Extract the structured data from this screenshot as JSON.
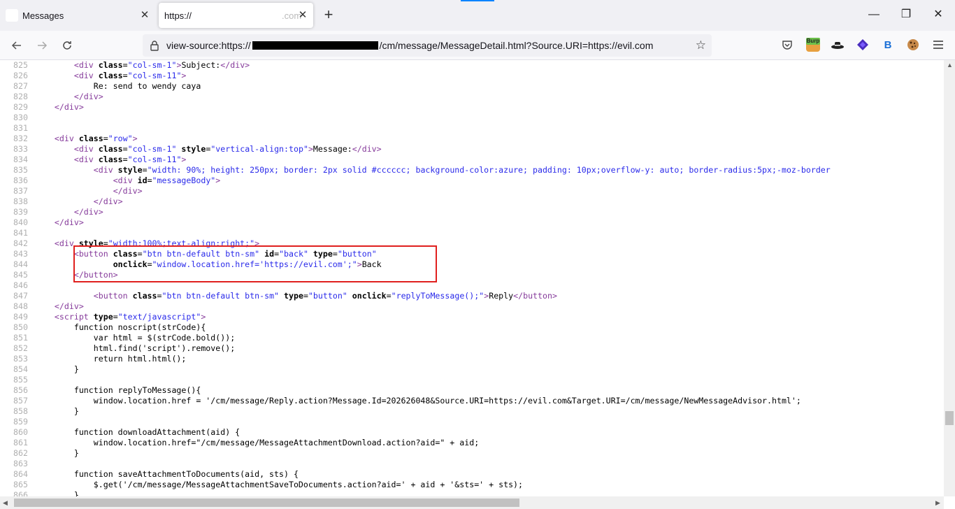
{
  "tabs": [
    {
      "label": "Messages",
      "active": false
    },
    {
      "label": "https://",
      "suffix": ".com",
      "active": true
    }
  ],
  "address": {
    "prefix": "view-source:https://",
    "suffix": "/cm/message/MessageDetail.html?Source.URI=https://evil.com"
  },
  "extensions": [
    {
      "name": "pocket-icon",
      "glyph": "♡"
    },
    {
      "name": "burp-icon",
      "glyph": "Burp"
    },
    {
      "name": "hat-icon",
      "glyph": "🎩"
    },
    {
      "name": "diamond-icon",
      "glyph": "◆"
    },
    {
      "name": "b-icon",
      "glyph": "B"
    },
    {
      "name": "cookie-icon",
      "glyph": "🍪"
    }
  ],
  "colors": {
    "highlight": "#e0201e",
    "tag": "#863b9b",
    "value": "#2a2aea"
  },
  "source_lines": [
    {
      "n": "825",
      "segs": [
        [
          "t",
          "        "
        ],
        [
          "tag",
          "<div"
        ],
        [
          "attr",
          " class"
        ],
        [
          "t",
          "="
        ],
        [
          "val",
          "\"col-sm-1\""
        ],
        [
          "tag",
          ">"
        ],
        [
          "t",
          "Subject:"
        ],
        [
          "tag",
          "</div>"
        ]
      ]
    },
    {
      "n": "826",
      "segs": [
        [
          "t",
          "        "
        ],
        [
          "tag",
          "<div"
        ],
        [
          "attr",
          " class"
        ],
        [
          "t",
          "="
        ],
        [
          "val",
          "\"col-sm-11\""
        ],
        [
          "tag",
          ">"
        ]
      ]
    },
    {
      "n": "827",
      "segs": [
        [
          "t",
          "            Re: send to wendy caya"
        ]
      ]
    },
    {
      "n": "828",
      "segs": [
        [
          "t",
          "        "
        ],
        [
          "tag",
          "</div>"
        ]
      ]
    },
    {
      "n": "829",
      "segs": [
        [
          "t",
          "    "
        ],
        [
          "tag",
          "</div>"
        ]
      ]
    },
    {
      "n": "830",
      "segs": []
    },
    {
      "n": "831",
      "segs": []
    },
    {
      "n": "832",
      "segs": [
        [
          "t",
          "    "
        ],
        [
          "tag",
          "<div"
        ],
        [
          "attr",
          " class"
        ],
        [
          "t",
          "="
        ],
        [
          "val",
          "\"row\""
        ],
        [
          "tag",
          ">"
        ]
      ]
    },
    {
      "n": "833",
      "segs": [
        [
          "t",
          "        "
        ],
        [
          "tag",
          "<div"
        ],
        [
          "attr",
          " class"
        ],
        [
          "t",
          "="
        ],
        [
          "val",
          "\"col-sm-1\""
        ],
        [
          "attr",
          " style"
        ],
        [
          "t",
          "="
        ],
        [
          "val",
          "\"vertical-align:top\""
        ],
        [
          "tag",
          ">"
        ],
        [
          "t",
          "Message:"
        ],
        [
          "tag",
          "</div>"
        ]
      ]
    },
    {
      "n": "834",
      "segs": [
        [
          "t",
          "        "
        ],
        [
          "tag",
          "<div"
        ],
        [
          "attr",
          " class"
        ],
        [
          "t",
          "="
        ],
        [
          "val",
          "\"col-sm-11\""
        ],
        [
          "tag",
          ">"
        ]
      ]
    },
    {
      "n": "835",
      "segs": [
        [
          "t",
          "            "
        ],
        [
          "tag",
          "<div"
        ],
        [
          "attr",
          " style"
        ],
        [
          "t",
          "="
        ],
        [
          "val",
          "\"width: 90%; height: 250px; border: 2px solid #cccccc; background-color:azure; padding: 10px;overflow-y: auto; border-radius:5px;-moz-border"
        ]
      ]
    },
    {
      "n": "836",
      "segs": [
        [
          "t",
          "                "
        ],
        [
          "tag",
          "<div"
        ],
        [
          "attr",
          " id"
        ],
        [
          "t",
          "="
        ],
        [
          "val",
          "\"messageBody\""
        ],
        [
          "tag",
          ">"
        ]
      ]
    },
    {
      "n": "837",
      "segs": [
        [
          "t",
          "                "
        ],
        [
          "tag",
          "</div>"
        ]
      ]
    },
    {
      "n": "838",
      "segs": [
        [
          "t",
          "            "
        ],
        [
          "tag",
          "</div>"
        ]
      ]
    },
    {
      "n": "839",
      "segs": [
        [
          "t",
          "        "
        ],
        [
          "tag",
          "</div>"
        ]
      ]
    },
    {
      "n": "840",
      "segs": [
        [
          "t",
          "    "
        ],
        [
          "tag",
          "</div>"
        ]
      ]
    },
    {
      "n": "841",
      "segs": []
    },
    {
      "n": "842",
      "segs": [
        [
          "t",
          "    "
        ],
        [
          "tag",
          "<div"
        ],
        [
          "attr",
          " style"
        ],
        [
          "t",
          "="
        ],
        [
          "val",
          "\"width:100%;text-align:right;\""
        ],
        [
          "tag",
          ">"
        ]
      ]
    },
    {
      "n": "843",
      "segs": [
        [
          "t",
          "        "
        ],
        [
          "tag",
          "<button"
        ],
        [
          "attr",
          " class"
        ],
        [
          "t",
          "="
        ],
        [
          "val",
          "\"btn btn-default btn-sm\""
        ],
        [
          "attr",
          " id"
        ],
        [
          "t",
          "="
        ],
        [
          "val",
          "\"back\""
        ],
        [
          "attr",
          " type"
        ],
        [
          "t",
          "="
        ],
        [
          "val",
          "\"button\""
        ]
      ]
    },
    {
      "n": "844",
      "segs": [
        [
          "t",
          "                "
        ],
        [
          "attr",
          "onclick"
        ],
        [
          "t",
          "="
        ],
        [
          "val",
          "\"window.location.href='https://evil.com';\""
        ],
        [
          "tag",
          ">"
        ],
        [
          "t",
          "Back"
        ]
      ]
    },
    {
      "n": "845",
      "segs": [
        [
          "t",
          "        "
        ],
        [
          "tag",
          "</button>"
        ]
      ]
    },
    {
      "n": "846",
      "segs": []
    },
    {
      "n": "847",
      "segs": [
        [
          "t",
          "            "
        ],
        [
          "tag",
          "<button"
        ],
        [
          "attr",
          " class"
        ],
        [
          "t",
          "="
        ],
        [
          "val",
          "\"btn btn-default btn-sm\""
        ],
        [
          "attr",
          " type"
        ],
        [
          "t",
          "="
        ],
        [
          "val",
          "\"button\""
        ],
        [
          "attr",
          " onclick"
        ],
        [
          "t",
          "="
        ],
        [
          "val",
          "\"replyToMessage();\""
        ],
        [
          "tag",
          ">"
        ],
        [
          "t",
          "Reply"
        ],
        [
          "tag",
          "</button>"
        ]
      ]
    },
    {
      "n": "848",
      "segs": [
        [
          "t",
          "    "
        ],
        [
          "tag",
          "</div>"
        ]
      ]
    },
    {
      "n": "849",
      "segs": [
        [
          "t",
          "    "
        ],
        [
          "tag",
          "<script"
        ],
        [
          "attr",
          " type"
        ],
        [
          "t",
          "="
        ],
        [
          "val",
          "\"text/javascript\""
        ],
        [
          "tag",
          ">"
        ]
      ]
    },
    {
      "n": "850",
      "segs": [
        [
          "t",
          "        function noscript(strCode){"
        ]
      ]
    },
    {
      "n": "851",
      "segs": [
        [
          "t",
          "            var html = $(strCode.bold());"
        ]
      ]
    },
    {
      "n": "852",
      "segs": [
        [
          "t",
          "            html.find('script').remove();"
        ]
      ]
    },
    {
      "n": "853",
      "segs": [
        [
          "t",
          "            return html.html();"
        ]
      ]
    },
    {
      "n": "854",
      "segs": [
        [
          "t",
          "        }"
        ]
      ]
    },
    {
      "n": "855",
      "segs": []
    },
    {
      "n": "856",
      "segs": [
        [
          "t",
          "        function replyToMessage(){"
        ]
      ]
    },
    {
      "n": "857",
      "segs": [
        [
          "t",
          "            window.location.href = '/cm/message/Reply.action?Message.Id=202626048&Source.URI=https://evil.com&Target.URI=/cm/message/NewMessageAdvisor.html';"
        ]
      ]
    },
    {
      "n": "858",
      "segs": [
        [
          "t",
          "        }"
        ]
      ]
    },
    {
      "n": "859",
      "segs": []
    },
    {
      "n": "860",
      "segs": [
        [
          "t",
          "        function downloadAttachment(aid) {"
        ]
      ]
    },
    {
      "n": "861",
      "segs": [
        [
          "t",
          "            window.location.href=\"/cm/message/MessageAttachmentDownload.action?aid=\" + aid;"
        ]
      ]
    },
    {
      "n": "862",
      "segs": [
        [
          "t",
          "        }"
        ]
      ]
    },
    {
      "n": "863",
      "segs": []
    },
    {
      "n": "864",
      "segs": [
        [
          "t",
          "        function saveAttachmentToDocuments(aid, sts) {"
        ]
      ]
    },
    {
      "n": "865",
      "segs": [
        [
          "t",
          "            $.get('/cm/message/MessageAttachmentSaveToDocuments.action?aid=' + aid + '&sts=' + sts);"
        ]
      ]
    },
    {
      "n": "866",
      "segs": [
        [
          "t",
          "        }"
        ]
      ]
    }
  ]
}
